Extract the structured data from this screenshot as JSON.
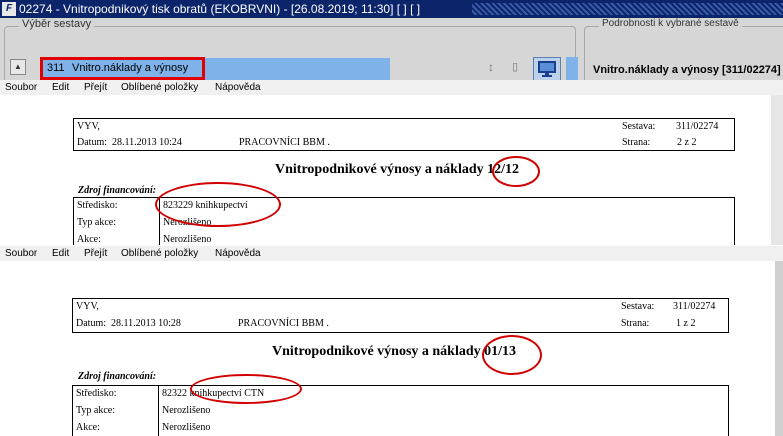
{
  "window": {
    "title": "02274 - Vnitropodnikový tisk obratů (EKOBRVNI) - [26.08.2019; 11:30]  [ ]  [ ]",
    "logo_text": "F"
  },
  "selection": {
    "group_label": "Výběr sestavy",
    "selected_code": "311",
    "selected_name": "Vnitro.náklady a výnosy"
  },
  "details": {
    "group_label": "Podrobnosti k vybrané sestavě",
    "value": "Vnitro.náklady a výnosy [311/02274]"
  },
  "icons": [
    "arrow-up-icon",
    "resize-vertical-icon",
    "pdf-icon",
    "monitor-icon"
  ],
  "menu": [
    "Soubor",
    "Edit",
    "Přejít",
    "Oblíbené položky",
    "Nápověda"
  ],
  "reports": [
    {
      "org": "VYV,",
      "datum_label": "Datum:",
      "datum": "28.11.2013 10:24",
      "pracovnici": "PRACOVNÍCI BBM .",
      "sestava_label": "Sestava:",
      "sestava": "311/02274",
      "strana_label": "Strana:",
      "strana": "2   z      2",
      "title": "Vnitropodnikové výnosy a náklady 12/12",
      "zdroj": "Zdroj financování:",
      "rows": [
        {
          "label": "Středisko:",
          "value": "823229   knihkupectví"
        },
        {
          "label": "Typ akce:",
          "value": "Nerozlišeno"
        },
        {
          "label": "Akce:",
          "value": "Nerozlišeno"
        }
      ]
    },
    {
      "org": "VYV,",
      "datum_label": "Datum:",
      "datum": "28.11.2013 10:28",
      "pracovnici": "PRACOVNÍCI BBM .",
      "sestava_label": "Sestava:",
      "sestava": "311/02274",
      "strana_label": "Strana:",
      "strana": "1   z      2",
      "title": "Vnitropodnikové výnosy a náklady 01/13",
      "zdroj": "Zdroj financování:",
      "rows": [
        {
          "label": "Středisko:",
          "value": "82322    knihkupectví CTN"
        },
        {
          "label": "Typ akce:",
          "value": "Nerozlišeno"
        },
        {
          "label": "Akce:",
          "value": "Nerozlišeno"
        }
      ]
    }
  ],
  "colors": {
    "titlebar": "#0b246a",
    "selection_bg": "#7fb2e8",
    "highlight_red": "#e00000"
  }
}
